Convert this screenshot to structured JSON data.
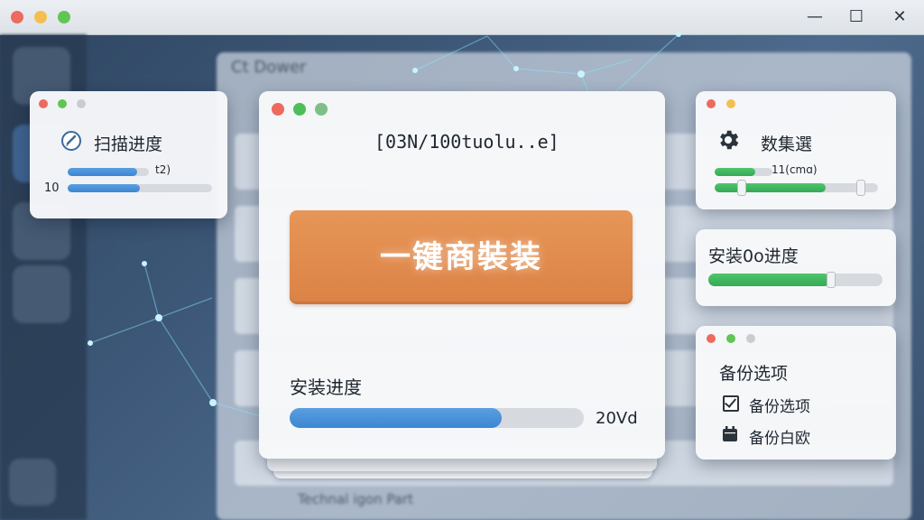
{
  "window": {
    "controls": {
      "minimize": "—",
      "maximize": "☐",
      "close": "✕"
    }
  },
  "background_app": {
    "panel_title": "Ct Dower",
    "footer_text": "Technal igon Part"
  },
  "scan_card": {
    "title": "扫描进度",
    "bar_label_right": "t2)",
    "bar_label_left": "10",
    "progress_top": 0.85,
    "progress_bottom": 0.5,
    "icon": "broom-scan-icon"
  },
  "center_card": {
    "header": "[03N/100tuolu..e]",
    "install_button": "一键商裝装",
    "progress_label": "安装进度",
    "progress_value_text": "20Vd",
    "progress": 0.72
  },
  "data_card": {
    "title": "数集選",
    "bar_label": "11(cmɑ)",
    "progress_top": 0.7,
    "progress_bottom": 0.68,
    "icon": "gear-icon"
  },
  "install_progress_card": {
    "title": "安装0o进度",
    "progress": 0.7
  },
  "backup_card": {
    "title": "备份选项",
    "options": [
      {
        "label": "备份选项",
        "checked": true
      },
      {
        "label": "备份白欧",
        "checked": false
      }
    ]
  },
  "colors": {
    "accent_orange": "#dc8246",
    "progress_blue": "#3c86d2",
    "progress_green": "#35a955",
    "traffic_red": "#ec6a5e",
    "traffic_yellow": "#f4bf4f",
    "traffic_green": "#61c554"
  }
}
